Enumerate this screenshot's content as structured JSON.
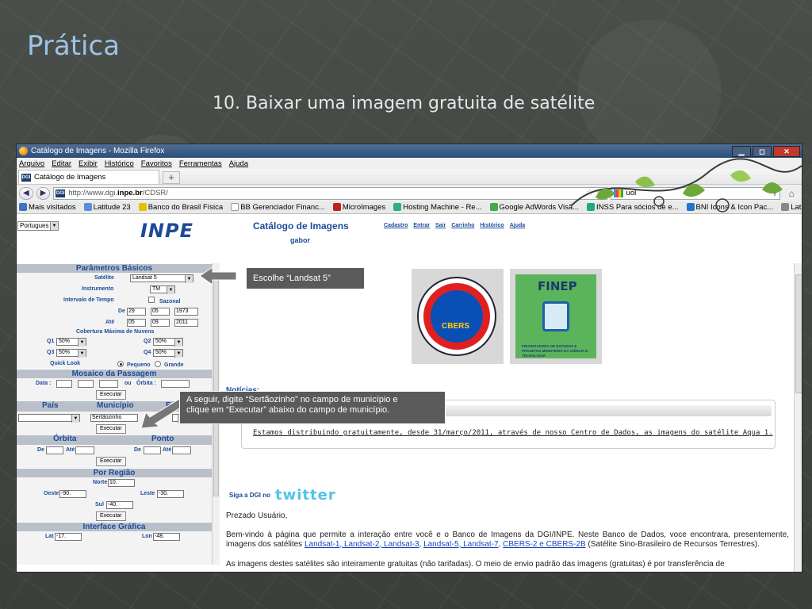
{
  "slide": {
    "title": "Prática",
    "subtitle": "10. Baixar uma imagem gratuita de satélite"
  },
  "browser": {
    "window_title": "Catálogo de Imagens - Mozilla Firefox",
    "menu": [
      "Arquivo",
      "Editar",
      "Exibir",
      "Histórico",
      "Favoritos",
      "Ferramentas",
      "Ajuda"
    ],
    "tab_label": "Catálogo de Imagens",
    "url_prefix": "http://www.dgi.",
    "url_host": "inpe.br",
    "url_suffix": "/CDSR/",
    "search_value": "uol",
    "bookmarks": [
      "Mais visitados",
      "Latitude 23",
      "Banco do Brasil Física",
      "BB Gerenciador Financ...",
      "MicroImages",
      "Hosting Machine - Re...",
      "Google AdWords Visã...",
      "INSS Para sócios de e...",
      "BNI Icons & Icon Pac...",
      "Latitude INPE"
    ]
  },
  "page": {
    "language": "Portugues",
    "logo": "INPE",
    "catalog_title": "Catálogo de Imagens",
    "user": "gabor",
    "links": [
      "Cadastro",
      "Entrar",
      "Sair",
      "Carrinho",
      "Histórico",
      "Ajuda"
    ]
  },
  "left": {
    "basic_params": "Parâmetros Básicos",
    "satellite_label": "Satélite",
    "satellite_value": "Landsat 5",
    "instrument_label": "Instrumento",
    "instrument_value": "TM",
    "time_label": "Intervalo de Tempo",
    "sazonal": "Sazonal",
    "from_label": "De",
    "from_day": "29",
    "from_month": "05",
    "from_year": "1973",
    "to_label": "Até",
    "to_day": "05",
    "to_month": "09",
    "to_year": "2011",
    "cloud_label": "Cobertura Máxima de Nuvens",
    "q1_label": "Q1",
    "q1": "50%",
    "q2_label": "Q2",
    "q2": "50%",
    "q3_label": "Q3",
    "q3": "50%",
    "q4_label": "Q4",
    "q4": "50%",
    "quicklook_label": "Quick Look",
    "small": "Pequeno",
    "large": "Grande",
    "mosaic": "Mosaico da Passagem",
    "date_label": "Data :",
    "ou_label": "ou",
    "orbita_label": "Órbita :",
    "exec": "Executar",
    "pais": "País",
    "municipio": "Município",
    "estado": "Esta",
    "municipio_value": "Sertãozinho",
    "orbit_section": "Órbita",
    "ponto_section": "Ponto",
    "orbit_de": "De",
    "orbit_ate": "Até",
    "ponto_de": "De",
    "ponto_ate": "Até",
    "region": "Por Região",
    "norte_label": "Norte",
    "norte": "10.",
    "oeste_label": "Oeste",
    "oeste": "-90.",
    "leste_label": "Leste",
    "leste": "-30.",
    "sul_label": "Sul",
    "sul": "-40.",
    "graphic": "Interface Gráfica",
    "lat_label": "Lat",
    "lat": "-17.",
    "lon_label": "Lon",
    "lon": "-48."
  },
  "content": {
    "cbers_text": "CBERS",
    "finep_title": "FINEP",
    "finep_small": "FINANCIADORA DE ESTUDOS E PROJETOS MINISTÉRIO DA CIÊNCIA E TECNOLOGIA",
    "news_title": "Notícias:",
    "news_text": "Estamos distribuindo gratuitamente, desde 31/março/2011, através de nosso Centro de Dados, as imagens do satélite Aqua 1.",
    "follow": "Siga a DGI no",
    "twitter": "twitter",
    "greeting": "Prezado Usuário,",
    "para_start": "Bem-vindo à página que permite a interação entre você e o Banco de Imagens da DGI/INPE. Neste Banco de Dados, voce encontrara, presentemente, imagens dos satélites ",
    "link1": "Landsat-1, Landsat-2, Landsat-3",
    "link2": "Landsat-5, Landsat-7",
    "link3": "CBERS-2 e CBERS-2B",
    "para_end": " (Satélite Sino-Brasileiro de Recursos Terrestres).",
    "cut_line": "As imagens destes satélites são inteiramente gratuitas (não tarifadas). O meio de envio padrão das imagens (gratuitas) é por transferência de"
  },
  "callouts": {
    "one": "Escolhe “Landsat 5”",
    "two_line1": "A seguir, digite “Sertãozinho” no campo de município e",
    "two_line2": "clique em “Executar”  abaixo do campo de município."
  }
}
